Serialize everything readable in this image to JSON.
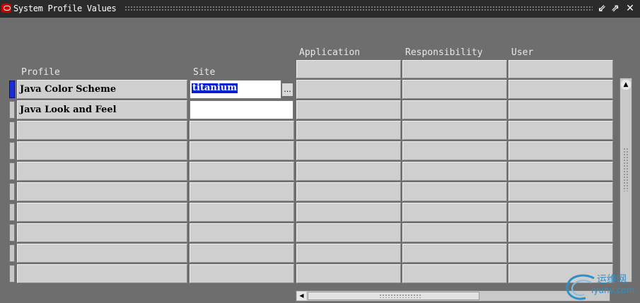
{
  "window": {
    "title": "System Profile Values",
    "buttons": {
      "minimize": "⇙",
      "maximize": "⇗",
      "close": "✕"
    }
  },
  "columns": {
    "profile": "Profile",
    "site": "Site",
    "application": "Application",
    "responsibility": "Responsibility",
    "user": "User"
  },
  "rows": [
    {
      "profile": "Java Color Scheme",
      "site": "titanium"
    },
    {
      "profile": "Java Look and Feel",
      "site": ""
    },
    {
      "profile": "",
      "site": ""
    },
    {
      "profile": "",
      "site": ""
    },
    {
      "profile": "",
      "site": ""
    },
    {
      "profile": "",
      "site": ""
    },
    {
      "profile": "",
      "site": ""
    },
    {
      "profile": "",
      "site": ""
    },
    {
      "profile": "",
      "site": ""
    },
    {
      "profile": "",
      "site": ""
    }
  ],
  "lov_button": "...",
  "watermark": {
    "line1": "运维网",
    "line2": "iyunv.com"
  },
  "colors": {
    "selection": "#0a1fd0",
    "title_logo": "#d10000",
    "current_row": "#1a2bd8"
  }
}
